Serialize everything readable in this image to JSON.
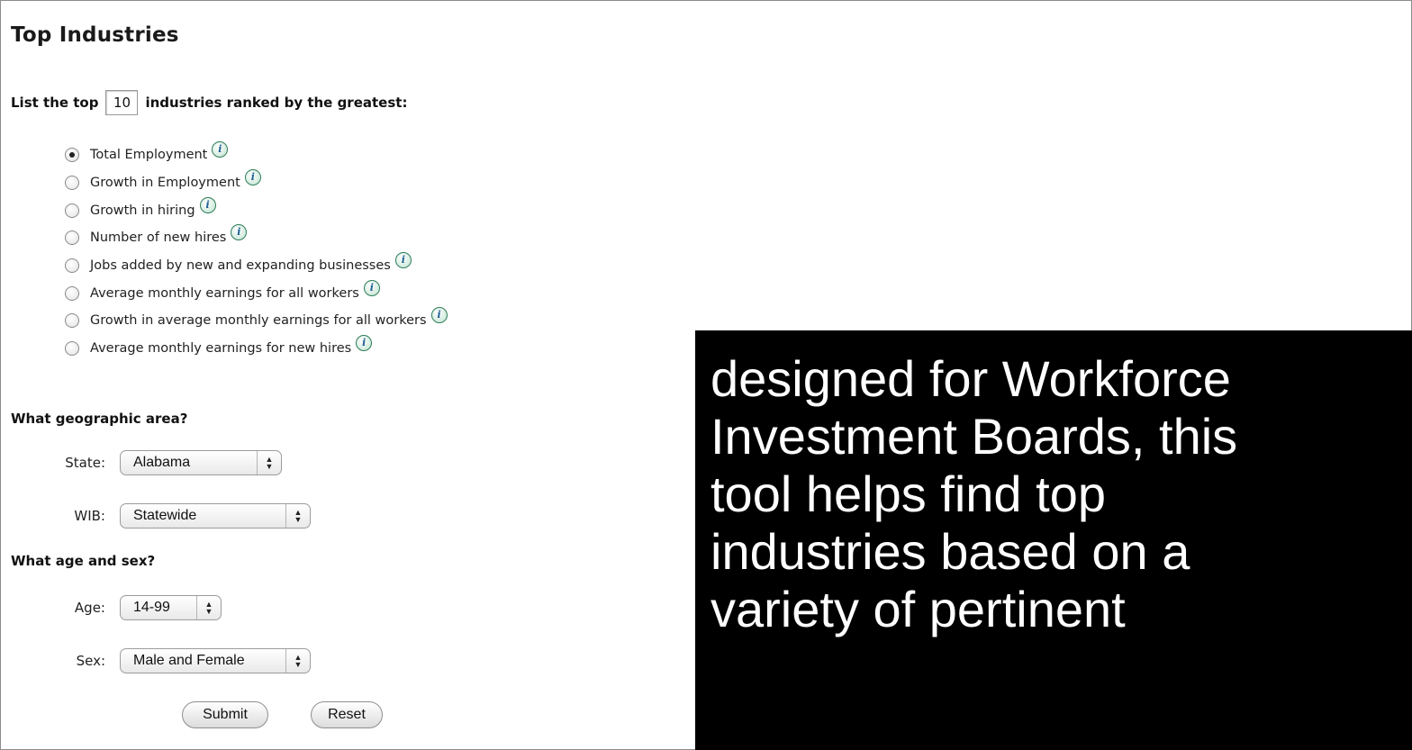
{
  "form": {
    "title": "Top Industries",
    "intro_prefix": "List the top",
    "top_count": "10",
    "intro_suffix": "industries ranked by the greatest:",
    "rank_options": [
      {
        "label": "Total Employment",
        "checked": true
      },
      {
        "label": "Growth in Employment",
        "checked": false
      },
      {
        "label": "Growth in hiring",
        "checked": false
      },
      {
        "label": "Number of new hires",
        "checked": false
      },
      {
        "label": "Jobs added by new and expanding businesses",
        "checked": false
      },
      {
        "label": "Average monthly earnings for all workers",
        "checked": false
      },
      {
        "label": "Growth in average monthly earnings for all workers",
        "checked": false
      },
      {
        "label": "Average monthly earnings for new hires",
        "checked": false
      }
    ],
    "info_icon_glyph": "i",
    "geo_heading": "What geographic area?",
    "state_label": "State:",
    "state_value": "Alabama",
    "wib_label": "WIB:",
    "wib_value": "Statewide",
    "demo_heading": "What age and sex?",
    "age_label": "Age:",
    "age_value": "14-99",
    "sex_label": "Sex:",
    "sex_value": "Male and Female",
    "submit_label": "Submit",
    "reset_label": "Reset"
  },
  "caption": {
    "lines": [
      "designed for Workforce",
      "Investment Boards, this",
      "tool helps find top",
      "industries based on a",
      "variety of pertinent"
    ]
  }
}
